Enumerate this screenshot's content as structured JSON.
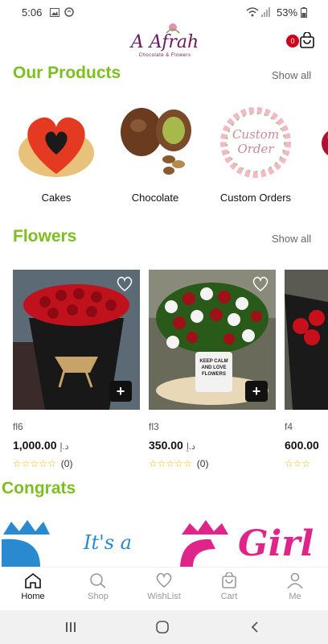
{
  "status_bar": {
    "time": "5:06",
    "battery": "53%"
  },
  "brand": {
    "name": "A Afrah",
    "tagline": "Chocolate & Flowers",
    "color": "#6b1a5e"
  },
  "header": {
    "cart_count": "0"
  },
  "accent_color": "#7cc020",
  "sections": {
    "products": {
      "title": "Our Products",
      "show_all": "Show all"
    },
    "flowers": {
      "title": "Flowers",
      "show_all": "Show all"
    },
    "congrats": {
      "title": "Congrats"
    }
  },
  "categories": [
    {
      "label": "Cakes",
      "icon": "heart-cake-image"
    },
    {
      "label": "Chocolate",
      "icon": "chocolate-image"
    },
    {
      "label": "Custom Orders",
      "icon": "custom-order-image"
    }
  ],
  "products": [
    {
      "name": "fl6",
      "price": "1,000.00",
      "currency": "د.إ",
      "stars": "☆☆☆☆☆",
      "reviews": "(0)"
    },
    {
      "name": "fl3",
      "price": "350.00",
      "currency": "د.إ",
      "stars": "☆☆☆☆☆",
      "reviews": "(0)"
    },
    {
      "name": "f4",
      "price": "600.00",
      "currency": "",
      "stars": "☆☆☆",
      "reviews": ""
    }
  ],
  "custom_order_text": "Custom Order",
  "mug_text": "KEEP CALM AND LOVE FLOWERS",
  "banner_text": {
    "left": "It's a",
    "right": "Girl"
  },
  "tabs": [
    {
      "label": "Home",
      "icon": "home-icon"
    },
    {
      "label": "Shop",
      "icon": "search-icon"
    },
    {
      "label": "WishList",
      "icon": "heart-icon"
    },
    {
      "label": "Cart",
      "icon": "bag-icon"
    },
    {
      "label": "Me",
      "icon": "person-icon"
    }
  ]
}
